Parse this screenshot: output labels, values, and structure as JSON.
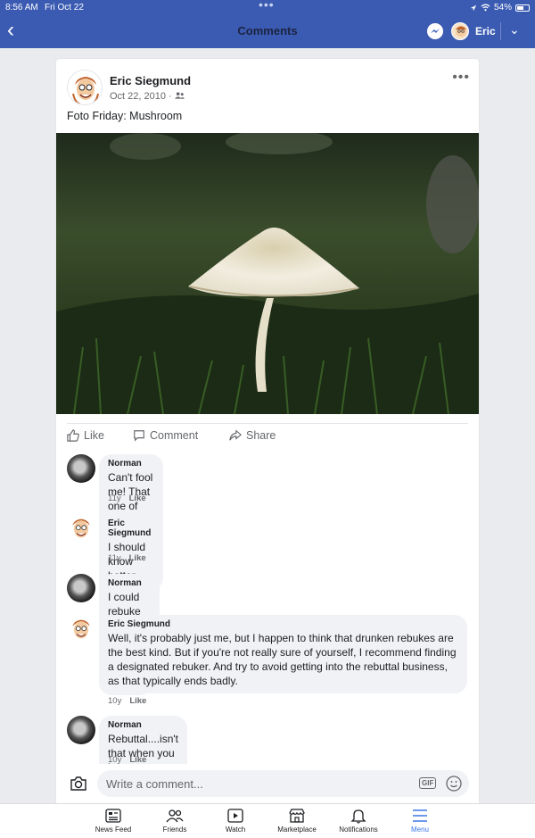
{
  "status_bar": {
    "time": "8:56 AM",
    "date": "Fri Oct 22",
    "battery": "54%"
  },
  "header": {
    "title": "Comments",
    "user_name": "Eric"
  },
  "post": {
    "author": "Eric Siegmund",
    "date": "Oct 22, 2010 · ",
    "text": "Foto Friday: Mushroom",
    "actions": {
      "like": "Like",
      "comment": "Comment",
      "share": "Share"
    }
  },
  "comments": [
    {
      "author": "Norman",
      "text": "Can't fool me! That one of those little umbrellas they put in drinks!",
      "age": "11y",
      "like": "Like"
    },
    {
      "author": "Eric Siegmund",
      "text": "I should know better than to try to dupe an expert!",
      "age": "11y",
      "like": "Like"
    },
    {
      "author": "Norman",
      "text": "I could rebuke that but I happen to be drunk.",
      "age": "",
      "like": ""
    },
    {
      "author": "Eric Siegmund",
      "text": "Well, it's probably just me, but I happen to think that drunken rebukes are the best kind. But if you're not really sure of yourself, I recommend finding a designated rebuker. And try to avoid getting into the rebuttal business, as that typically ends badly.",
      "age": "10y",
      "like": "Like"
    },
    {
      "author": "Norman",
      "text": "Rebuttal....isn't that when you have your rear end replaced?",
      "age": "10y",
      "like": "Like"
    }
  ],
  "composer": {
    "placeholder": "Write a comment...",
    "gif": "GIF"
  },
  "tabs": [
    {
      "label": "News Feed",
      "icon": "news-feed-icon"
    },
    {
      "label": "Friends",
      "icon": "friends-icon"
    },
    {
      "label": "Watch",
      "icon": "watch-icon"
    },
    {
      "label": "Marketplace",
      "icon": "marketplace-icon"
    },
    {
      "label": "Notifications",
      "icon": "bell-icon"
    },
    {
      "label": "Menu",
      "icon": "menu-icon",
      "active": true
    }
  ],
  "colors": {
    "header_bg": "#3b5bb3",
    "active_tab": "#3b78e7",
    "bubble": "#f0f2f5"
  }
}
